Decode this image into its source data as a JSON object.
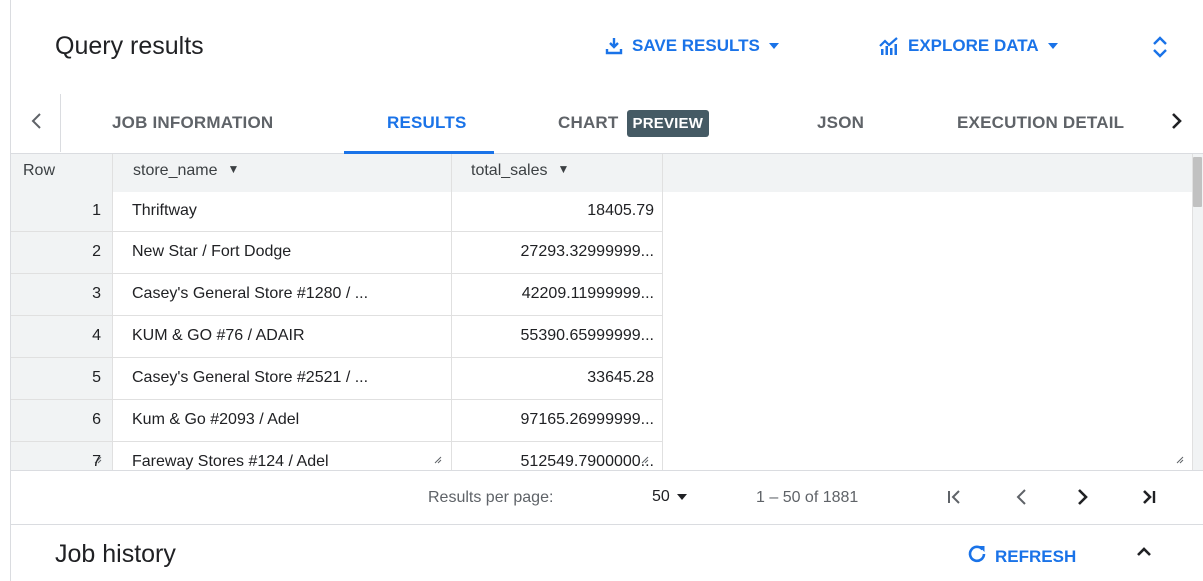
{
  "header": {
    "title": "Query results",
    "save_results_label": "SAVE RESULTS",
    "explore_data_label": "EXPLORE DATA"
  },
  "tabs": [
    {
      "label": "JOB INFORMATION",
      "active": false
    },
    {
      "label": "RESULTS",
      "active": true
    },
    {
      "label": "CHART",
      "active": false,
      "badge": "PREVIEW"
    },
    {
      "label": "JSON",
      "active": false
    },
    {
      "label": "EXECUTION DETAIL",
      "active": false
    }
  ],
  "table": {
    "columns": [
      "Row",
      "store_name",
      "total_sales"
    ],
    "rows": [
      {
        "row": "1",
        "store_name": "Thriftway",
        "total_sales": "18405.79"
      },
      {
        "row": "2",
        "store_name": "New Star / Fort Dodge",
        "total_sales": "27293.32999999..."
      },
      {
        "row": "3",
        "store_name": "Casey's General Store #1280 / ...",
        "total_sales": "42209.11999999..."
      },
      {
        "row": "4",
        "store_name": "KUM & GO #76 / ADAIR",
        "total_sales": "55390.65999999..."
      },
      {
        "row": "5",
        "store_name": "Casey's General Store #2521 / ...",
        "total_sales": "33645.28"
      },
      {
        "row": "6",
        "store_name": "Kum & Go #2093 / Adel",
        "total_sales": "97165.26999999..."
      },
      {
        "row": "7",
        "store_name": "Fareway Stores #124 / Adel",
        "total_sales": "512549.7900000..."
      }
    ]
  },
  "pagination": {
    "results_per_page_label": "Results per page:",
    "results_per_page_value": "50",
    "range_text": "1 – 50 of 1881"
  },
  "job_history": {
    "title": "Job history",
    "refresh_label": "REFRESH"
  },
  "colors": {
    "accent": "#1a73e8",
    "badge_bg": "#455a64",
    "header_bg": "#f1f3f4"
  }
}
